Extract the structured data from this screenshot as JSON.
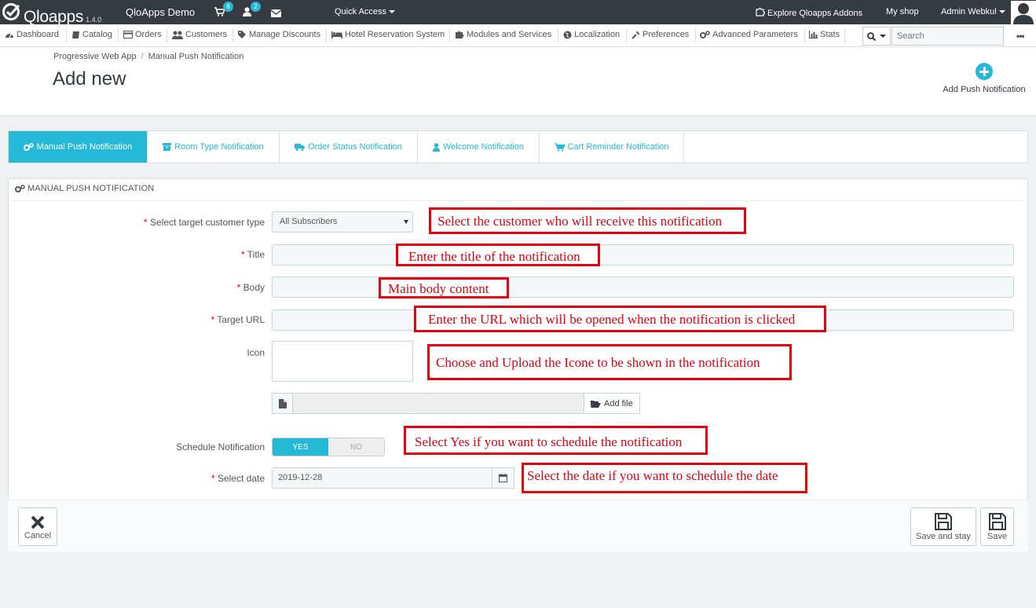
{
  "topbar": {
    "logo_text": "Qloapps",
    "version": "1.4.0",
    "shop_name": "QloApps Demo",
    "cart_badge": "8",
    "customers_badge": "2",
    "quick_access": "Quick Access",
    "explore": "Explore Qloapps Addons",
    "my_shop": "My shop",
    "admin": "Admin Webkul"
  },
  "nav": {
    "items": [
      {
        "label": "Dashboard",
        "icon": "dashboard-icon"
      },
      {
        "label": "Catalog",
        "icon": "book-icon"
      },
      {
        "label": "Orders",
        "icon": "credit-card-icon"
      },
      {
        "label": "Customers",
        "icon": "users-icon"
      },
      {
        "label": "Manage Discounts",
        "icon": "tag-icon"
      },
      {
        "label": "Hotel Reservation System",
        "icon": "bed-icon"
      },
      {
        "label": "Modules and Services",
        "icon": "puzzle-icon"
      },
      {
        "label": "Localization",
        "icon": "globe-icon"
      },
      {
        "label": "Preferences",
        "icon": "wrench-icon"
      },
      {
        "label": "Advanced Parameters",
        "icon": "cogs-icon"
      },
      {
        "label": "Stats",
        "icon": "bar-chart-icon"
      }
    ],
    "search_placeholder": "Search",
    "more": "•••"
  },
  "header": {
    "breadcrumb_parent": "Progressive Web App",
    "breadcrumb_current": "Manual Push Notification",
    "title": "Add new",
    "add_button": "Add Push Notification"
  },
  "tabs": [
    {
      "label": "Manual Push Notification",
      "icon": "cogs-icon",
      "active": true
    },
    {
      "label": "Room Type Notification",
      "icon": "archive-icon",
      "active": false
    },
    {
      "label": "Order Status Notification",
      "icon": "truck-icon",
      "active": false
    },
    {
      "label": "Welcome Notification",
      "icon": "user-icon",
      "active": false
    },
    {
      "label": "Cart Reminder Notification",
      "icon": "cart-icon",
      "active": false
    }
  ],
  "form": {
    "panel_title": "MANUAL PUSH NOTIFICATION",
    "target_label": "Select target customer type",
    "target_value": "All Subscribers",
    "title_label": "Title",
    "title_value": "",
    "body_label": "Body",
    "body_value": "",
    "url_label": "Target URL",
    "url_value": "",
    "icon_label": "Icon",
    "add_file": "Add file",
    "schedule_label": "Schedule Notification",
    "schedule_yes": "YES",
    "schedule_no": "NO",
    "schedule_value": "YES",
    "date_label": "Select date",
    "date_value": "2019-12-28",
    "required_mark": "*",
    "cancel": "Cancel",
    "save_and_stay": "Save and stay",
    "save": "Save"
  },
  "annotations": {
    "customer": "Select the customer who will receive this notification",
    "title": "Enter the title of the notification",
    "body": "Main body content",
    "url": "Enter the URL which will be opened when the notification is clicked",
    "icon": "Choose and Upload the Icone to be shown in the notification",
    "schedule": "Select Yes if you want to schedule the notification",
    "date": "Select the date if you want to schedule the date"
  },
  "colors": {
    "topbar": "#363a41",
    "accent": "#25b9d7",
    "annotation": "#e3000f"
  }
}
